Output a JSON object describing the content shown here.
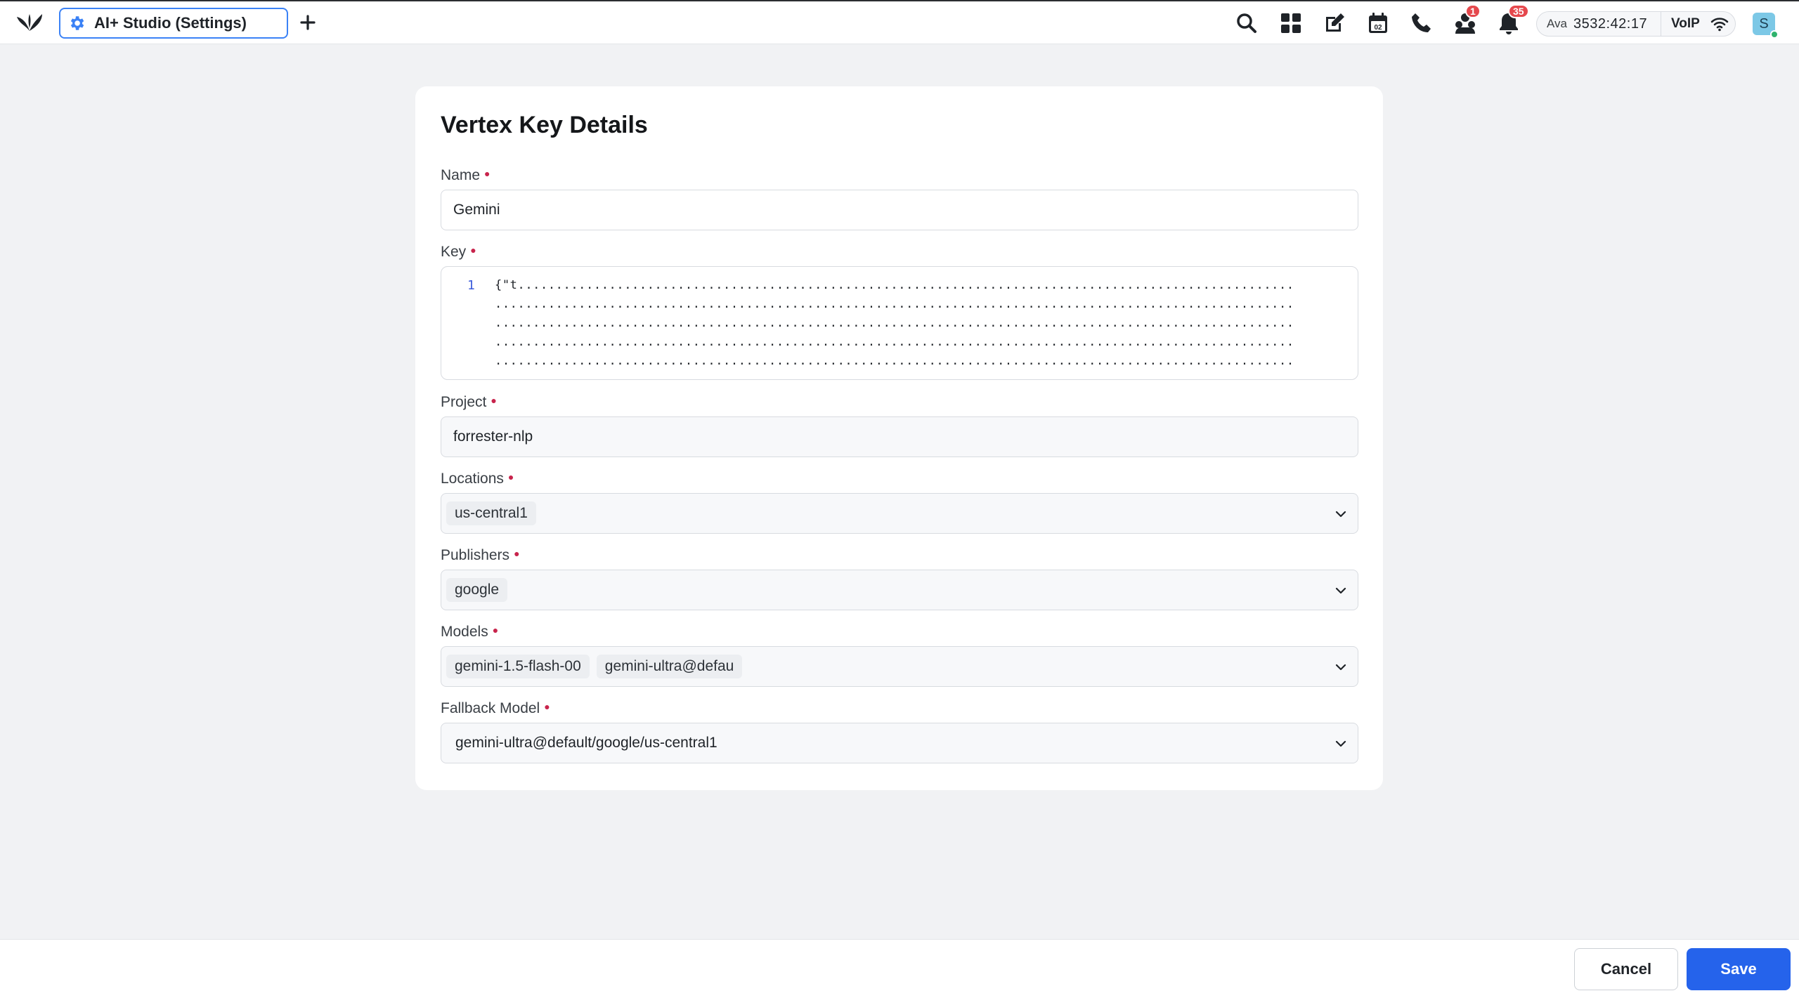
{
  "header": {
    "tab_label": "AI+ Studio (Settings)",
    "badges": {
      "notifications_agent": "1",
      "notifications_bell": "35"
    },
    "status": {
      "agent": "Ava",
      "timer": "3532:42:17",
      "voip": "VoIP"
    },
    "avatar_initial": "S",
    "calendar_day": "02"
  },
  "form": {
    "title": "Vertex Key Details",
    "name": {
      "label": "Name",
      "value": "Gemini"
    },
    "key": {
      "label": "Key",
      "line_number": "1",
      "lines": [
        "{\"t......................................................................................................",
        ".........................................................................................................",
        ".........................................................................................................",
        ".........................................................................................................",
        "........................................................................................................."
      ]
    },
    "project": {
      "label": "Project",
      "value": "forrester-nlp"
    },
    "locations": {
      "label": "Locations",
      "chips": [
        "us-central1"
      ]
    },
    "publishers": {
      "label": "Publishers",
      "chips": [
        "google"
      ]
    },
    "models": {
      "label": "Models",
      "chips": [
        "gemini-1.5-flash-00",
        "gemini-ultra@defau"
      ]
    },
    "fallback_model": {
      "label": "Fallback Model",
      "value": "gemini-ultra@default/google/us-central1"
    }
  },
  "footer": {
    "cancel_label": "Cancel",
    "save_label": "Save"
  },
  "colors": {
    "primary": "#2563eb",
    "required": "#c8244c",
    "badge": "#e5484d",
    "tab_border": "#3b82f6"
  }
}
